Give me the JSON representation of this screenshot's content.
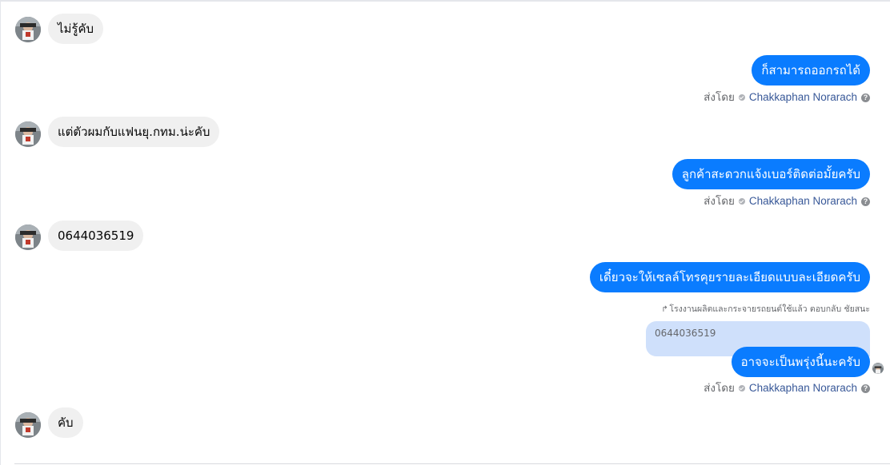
{
  "messages": {
    "m1": {
      "text": "ไม่รู้คับ"
    },
    "m2": {
      "text": "ก็สามารถออกรถได้",
      "sent_by_label": "ส่งโดย",
      "sender": "Chakkaphan Norarach"
    },
    "m3": {
      "text": "แต่ตัวผมกับแฟนยุ.กทม.น่ะคับ"
    },
    "m4": {
      "text": "ลูกค้าสะดวกแจ้งเบอร์ติดต่อมั้ยครับ",
      "sent_by_label": "ส่งโดย",
      "sender": "Chakkaphan Norarach"
    },
    "m5": {
      "text": "0644036519"
    },
    "m6": {
      "text": "เดี๋ยวจะให้เซลล์โทรคุยรายละเอียดแบบละเอียดครับ"
    },
    "reply_note": "โรงงานผลิตและกระจายรถยนต์ใช้แล้ว ตอบกลับ ชัยสนะ",
    "quoted_text": "0644036519",
    "m7": {
      "text": "อาจจะเป็นพรุ่งนี้นะครับ",
      "sent_by_label": "ส่งโดย",
      "sender": "Chakkaphan Norarach"
    },
    "m8": {
      "text": "คับ"
    }
  },
  "icons": {
    "verified": "check-circle-icon",
    "help": "question-circle-icon",
    "reply": "reply-arrow-icon"
  },
  "colors": {
    "outgoing_bubble": "#0a7cff",
    "incoming_bubble": "#f0f0f0",
    "quoted_bubble": "#cfe0fb",
    "sender_link": "#385898"
  }
}
